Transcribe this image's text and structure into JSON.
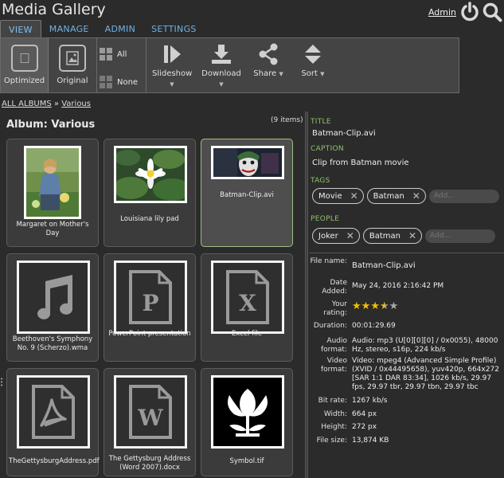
{
  "app": {
    "title": "Media Gallery",
    "admin_link": "Admin",
    "power_icon": "power-icon",
    "search_icon": "search-icon"
  },
  "tabs": [
    {
      "label": "VIEW",
      "active": true
    },
    {
      "label": "MANAGE",
      "active": false
    },
    {
      "label": "ADMIN",
      "active": false
    },
    {
      "label": "SETTINGS",
      "active": false
    }
  ],
  "toolbar": {
    "optimized": "Optimized",
    "original": "Original",
    "select_all": "All",
    "select_none": "None",
    "slideshow": "Slideshow",
    "download": "Download",
    "share": "Share",
    "sort": "Sort"
  },
  "breadcrumb": {
    "root": "ALL ALBUMS",
    "separator": "»",
    "current": "Various"
  },
  "album": {
    "title": "Album: Various",
    "count": "(9 items)",
    "items": [
      {
        "caption": "Margaret on Mother's Day",
        "kind": "photo"
      },
      {
        "caption": "Louisiana lily pad",
        "kind": "photo"
      },
      {
        "caption": "Batman-Clip.avi",
        "kind": "video",
        "selected": true
      },
      {
        "caption": "Beethoven's Symphony No. 9 (Scherzo).wma",
        "kind": "audio"
      },
      {
        "caption": "PowerPoint presentation",
        "kind": "ppt",
        "letter": "P"
      },
      {
        "caption": "Excel file",
        "kind": "xls",
        "letter": "X"
      },
      {
        "caption": "TheGettysburgAddress.pdf",
        "kind": "pdf"
      },
      {
        "caption": "The Gettysburg Address (Word 2007).docx",
        "kind": "doc",
        "letter": "W"
      },
      {
        "caption": "Symbol.tif",
        "kind": "image"
      }
    ]
  },
  "details": {
    "title_label": "TITLE",
    "title": "Batman-Clip.avi",
    "caption_label": "CAPTION",
    "caption": "Clip from Batman movie",
    "tags_label": "TAGS",
    "tags": [
      "Movie",
      "Batman"
    ],
    "tags_placeholder": "Add...",
    "people_label": "PEOPLE",
    "people": [
      "Joker",
      "Batman"
    ],
    "people_placeholder": "Add...",
    "props": {
      "file_name_key": "File name:",
      "file_name": "Batman-Clip.avi",
      "date_added_key": "Date Added:",
      "date_added": "May 24, 2016 2:16:42 PM",
      "rating_key": "Your rating:",
      "rating_value": 3.5,
      "rating_max": 5,
      "duration_key": "Duration:",
      "duration": "00:01:29.69",
      "audio_key": "Audio format:",
      "audio": "Audio: mp3 (U[0][0][0] / 0x0055), 48000 Hz, stereo, s16p, 224 kb/s",
      "video_key": "Video format:",
      "video": "Video: mpeg4 (Advanced Simple Profile) (XVID / 0x44495658), yuv420p, 664x272 [SAR 1:1 DAR 83:34], 1026 kb/s, 29.97 fps, 29.97 tbr, 29.97 tbn, 29.97 tbc",
      "bitrate_key": "Bit rate:",
      "bitrate": "1267 kb/s",
      "width_key": "Width:",
      "width": "664 px",
      "height_key": "Height:",
      "height": "272 px",
      "filesize_key": "File size:",
      "filesize": "13,874 KB"
    }
  },
  "colors": {
    "accent_blue": "#6fb3e8",
    "section_green": "#90c06c",
    "star": "#f0c000",
    "background": "#2b2b2b"
  }
}
